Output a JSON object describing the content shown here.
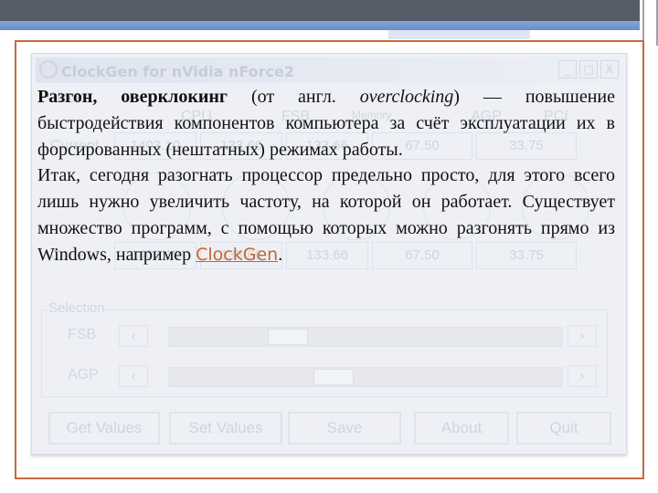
{
  "background_app": {
    "title": "ClockGen for nVidia nForce2",
    "window_buttons": [
      "_",
      "□",
      "X"
    ],
    "clocks_label": "Clocks",
    "columns": [
      "CPU",
      "FSB",
      "Memory",
      "AGP",
      "PCI"
    ],
    "current_label": "Current",
    "current_values": [
      "1403.10",
      "133.66",
      "133.66",
      "67.50",
      "33.75"
    ],
    "selected_values": [
      "1403.10",
      "133.66",
      "133.66",
      "67.50",
      "33.75"
    ],
    "selection_label": "Selection",
    "sliders": [
      {
        "label": "FSB",
        "position": 0.28
      },
      {
        "label": "AGP",
        "position": 0.41
      }
    ],
    "buttons": [
      "Get Values",
      "Set Values",
      "Save",
      "About",
      "Quit"
    ]
  },
  "slide": {
    "para1_bold": "Разгон, оверклокинг",
    "para1_a": " (от англ. ",
    "para1_italic": "overclocking",
    "para1_b": ") — повышение быстродействия компонентов компьютера за счёт эксплуатации их в форсированных (нештатных) режимах работы.",
    "para2": " Итак, сегодня разогнать процессор предельно просто, для этого всего лишь нужно увеличить частоту, на которой он работает. Существует множество программ, с помощью которых можно разгонять прямо из Windows, например ",
    "link": "ClockGen",
    "para2_end": "."
  },
  "colors": {
    "accent_border": "#c9683a",
    "link": "#c9642d",
    "top_bar": "#565d68",
    "blue_bar": "#6c8cc8"
  }
}
